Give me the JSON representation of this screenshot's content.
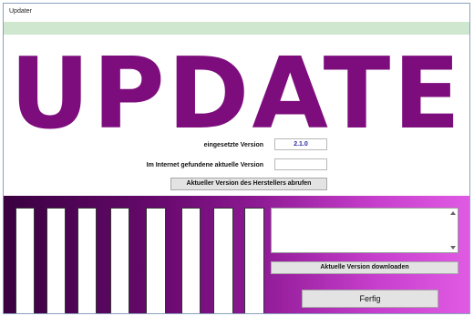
{
  "window": {
    "title": "Updater"
  },
  "logo": {
    "text": "UPDATE",
    "color": "#7d0d7d"
  },
  "installed_version": {
    "label": "eingesetzte Version",
    "value": "2.1.0"
  },
  "online_version": {
    "label": "Im Internet gefundene aktuelle Version",
    "value": ""
  },
  "buttons": {
    "fetch_label": "Aktueller Version des Herstellers abrufen",
    "download_label": "Aktuelle Version downloaden",
    "done_label": "Ferfig"
  },
  "colors": {
    "accent": "#7d0d7d",
    "header_strip": "#cfe6cf"
  }
}
